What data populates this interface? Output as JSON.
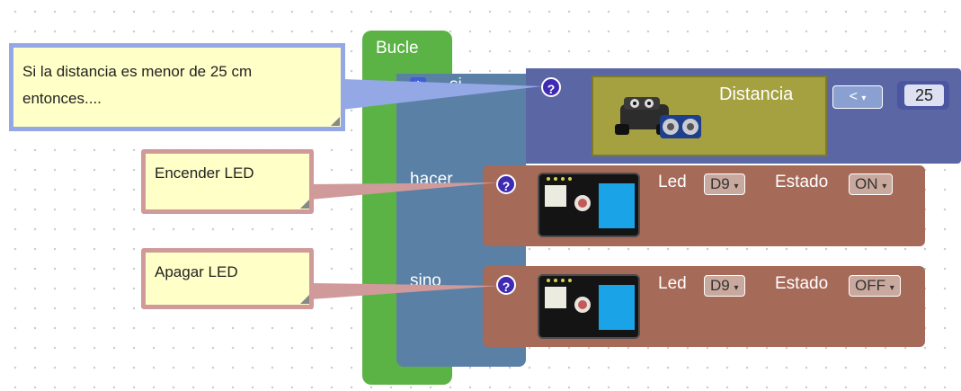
{
  "loop": {
    "title": "Bucle"
  },
  "if_block": {
    "label": "si",
    "do_label": "hacer",
    "else_label": "sino",
    "help_symbol": "?",
    "gear_icon": "gear-icon"
  },
  "condition": {
    "sensor_label": "Distancia",
    "operator": "<",
    "value": "25"
  },
  "led_on": {
    "led_label": "Led",
    "pin": "D9",
    "state_label": "Estado",
    "state": "ON"
  },
  "led_off": {
    "led_label": "Led",
    "pin": "D9",
    "state_label": "Estado",
    "state": "OFF"
  },
  "comments": {
    "condition": "Si la distancia es menor de 25 cm entonces....",
    "on": "Encender LED",
    "off": "Apagar LED"
  },
  "colors": {
    "loop": "#5bb346",
    "if": "#5b80a5",
    "sensor": "#a5a140",
    "led": "#a66a58",
    "help": "#3e2ab3"
  }
}
